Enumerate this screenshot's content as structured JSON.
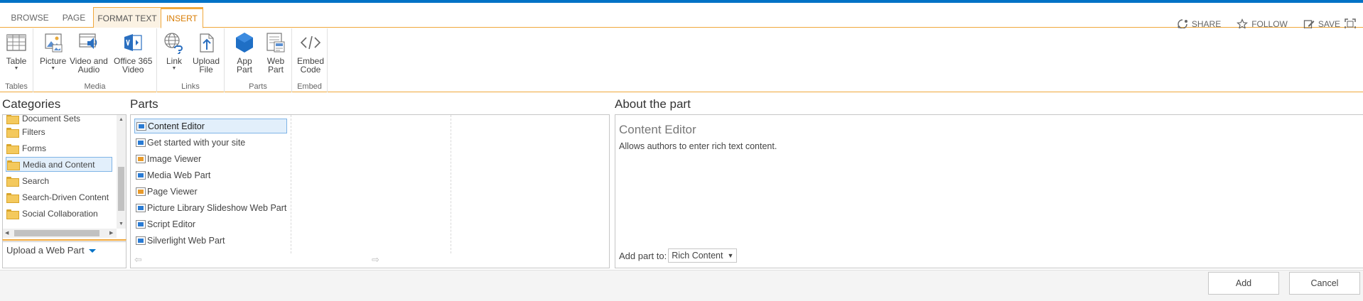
{
  "ribbon": {
    "tabs": [
      {
        "label": "BROWSE"
      },
      {
        "label": "PAGE"
      },
      {
        "label": "FORMAT TEXT"
      },
      {
        "label": "INSERT"
      }
    ],
    "active_tab": "INSERT",
    "actions": {
      "share": "SHARE",
      "follow": "FOLLOW",
      "save": "SAVE"
    },
    "groups": {
      "tables": {
        "label": "Tables",
        "table": "Table"
      },
      "media": {
        "label": "Media",
        "picture": "Picture",
        "video_audio_1": "Video and",
        "video_audio_2": "Audio",
        "o365_1": "Office 365",
        "o365_2": "Video"
      },
      "links": {
        "label": "Links",
        "link": "Link",
        "upload_1": "Upload",
        "upload_2": "File"
      },
      "parts": {
        "label": "Parts",
        "app_1": "App",
        "app_2": "Part",
        "web_1": "Web",
        "web_2": "Part"
      },
      "embed": {
        "label": "Embed",
        "embed_1": "Embed",
        "embed_2": "Code"
      }
    }
  },
  "categories": {
    "heading": "Categories",
    "items": [
      {
        "label": "Document Sets"
      },
      {
        "label": "Filters"
      },
      {
        "label": "Forms"
      },
      {
        "label": "Media and Content"
      },
      {
        "label": "Search"
      },
      {
        "label": "Search-Driven Content"
      },
      {
        "label": "Social Collaboration"
      }
    ],
    "selected": "Media and Content",
    "upload_label": "Upload a Web Part"
  },
  "parts": {
    "heading": "Parts",
    "items": [
      {
        "label": "Content Editor"
      },
      {
        "label": "Get started with your site"
      },
      {
        "label": "Image Viewer"
      },
      {
        "label": "Media Web Part"
      },
      {
        "label": "Page Viewer"
      },
      {
        "label": "Picture Library Slideshow Web Part"
      },
      {
        "label": "Script Editor"
      },
      {
        "label": "Silverlight Web Part"
      }
    ],
    "selected": "Content Editor"
  },
  "about": {
    "heading": "About the part",
    "title": "Content Editor",
    "description": "Allows authors to enter rich text content.",
    "add_part_label": "Add part to:",
    "zone_value": "Rich Content"
  },
  "footer": {
    "add": "Add",
    "cancel": "Cancel"
  },
  "colors": {
    "accent": "#0072c6",
    "context_tab": "#f0a83c",
    "selection": "#e2effb"
  }
}
